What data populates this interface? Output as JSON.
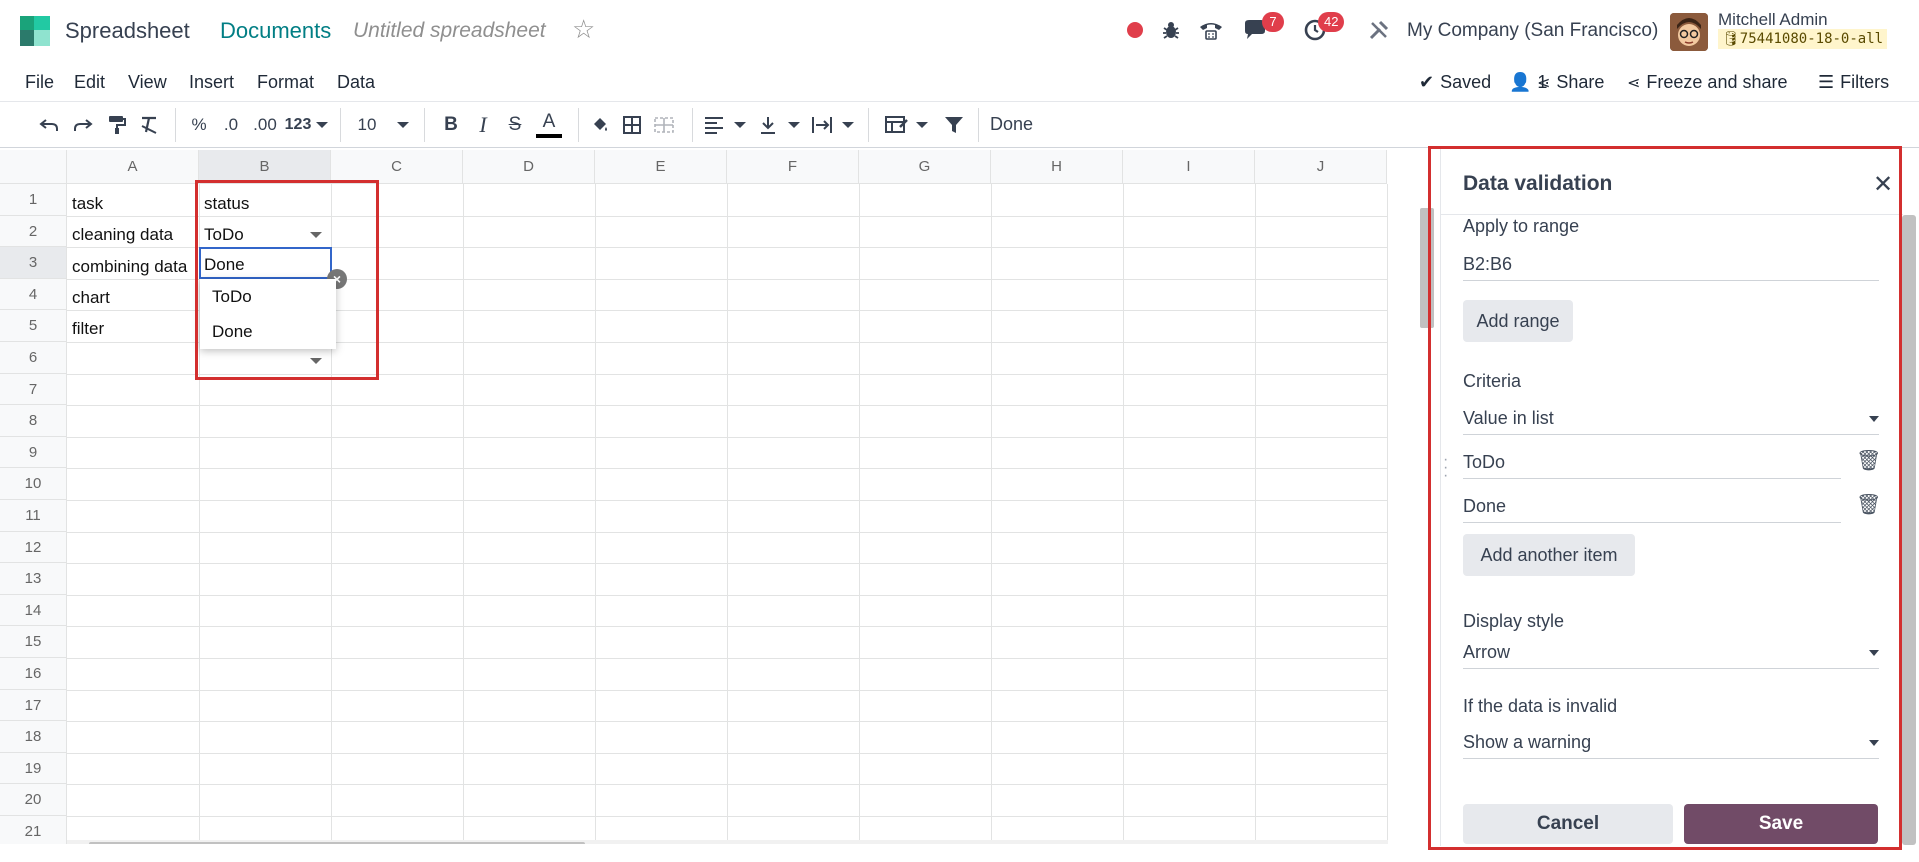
{
  "topbar": {
    "app_name": "Spreadsheet",
    "breadcrumb_documents": "Documents",
    "document_title": "Untitled spreadsheet",
    "messages_count": "7",
    "activities_count": "42",
    "company": "My Company (San Francisco)",
    "user_name": "Mitchell Admin",
    "database": "75441080-18-0-all"
  },
  "menubar": {
    "items": [
      "File",
      "Edit",
      "View",
      "Insert",
      "Format",
      "Data"
    ],
    "saved": "Saved",
    "users_count": "1",
    "share": "Share",
    "freeze_share": "Freeze and share",
    "filters": "Filters"
  },
  "toolbar": {
    "percent": "%",
    "dec_less": ".0",
    "dec_more": ".00",
    "number_format": "123",
    "font_size": "10",
    "bold": "B",
    "italic": "I",
    "strike": "S",
    "text_color": "A",
    "formula_value": "Done"
  },
  "grid": {
    "columns": [
      "A",
      "B",
      "C",
      "D",
      "E",
      "F",
      "G",
      "H",
      "I",
      "J"
    ],
    "rows": [
      "1",
      "2",
      "3",
      "4",
      "5",
      "6",
      "7",
      "8",
      "9",
      "10",
      "11",
      "12",
      "13",
      "14",
      "15",
      "16",
      "17",
      "18",
      "19",
      "20",
      "21"
    ],
    "cells": {
      "A1": "task",
      "B1": "status",
      "A2": "cleaning data",
      "B2": "ToDo",
      "A3": " combining data",
      "B3": "Done",
      "A4": "chart",
      "A5": "filter"
    },
    "dropdown_options": [
      "ToDo",
      "Done"
    ]
  },
  "panel": {
    "title": "Data validation",
    "apply_to_range_label": "Apply to range",
    "range_value": "B2:B6",
    "add_range": "Add range",
    "criteria_label": "Criteria",
    "criteria_value": "Value in list",
    "list_items": [
      "ToDo",
      "Done"
    ],
    "add_item": "Add another item",
    "display_style_label": "Display style",
    "display_style_value": "Arrow",
    "invalid_label": "If the data is invalid",
    "invalid_value": "Show a warning",
    "cancel": "Cancel",
    "save": "Save"
  },
  "colors": {
    "accent_teal": "#017e84",
    "badge_red": "#e03e4b",
    "save_purple": "#714b67",
    "highlight_red": "#d32f2f",
    "selection_blue": "#3266ca"
  }
}
